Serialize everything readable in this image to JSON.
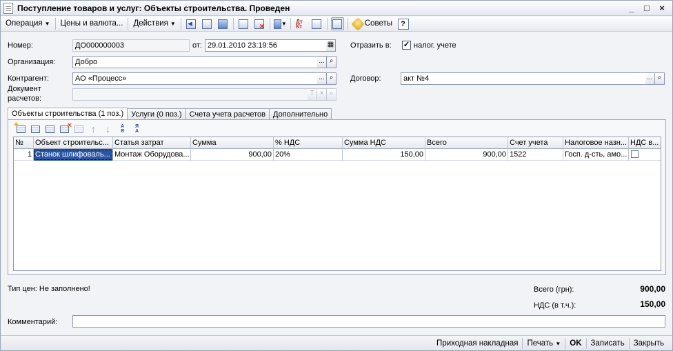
{
  "window": {
    "title": "Поступление товаров и услуг: Объекты строительства. Проведен",
    "controls": [
      "_",
      "□",
      "×"
    ]
  },
  "toolbar": {
    "operation": "Операция",
    "prices": "Цены и валюта...",
    "actions": "Действия",
    "tips": "Советы",
    "help": "?"
  },
  "form": {
    "number_label": "Номер:",
    "number_value": "ДО000000003",
    "date_label": "от:",
    "date_value": "29.01.2010 23:19:56",
    "reflect_label": "Отразить в:",
    "tax_checkbox_label": "налог. учете",
    "tax_checked": true,
    "org_label": "Организация:",
    "org_value": "Добро",
    "counterparty_label": "Контрагент:",
    "counterparty_value": "АО «Процесс»",
    "contract_label": "Договор:",
    "contract_value": "акт №4",
    "doc_label_1": "Документ",
    "doc_label_2": "расчетов:",
    "doc_value": "",
    "select_btn": "...",
    "clear_btn": "×",
    "type_btn": "T"
  },
  "tabs": [
    {
      "label": "Объекты строительства (1 поз.)",
      "active": true
    },
    {
      "label": "Услуги (0 поз.)",
      "active": false
    },
    {
      "label": "Счета учета расчетов",
      "active": false
    },
    {
      "label": "Дополнительно",
      "active": false
    }
  ],
  "grid": {
    "columns": [
      "№",
      "Объект строительс...",
      "Статья затрат",
      "Сумма",
      "% НДС",
      "Сумма НДС",
      "Всего",
      "Счет учета",
      "Налоговое назн...",
      "НДС в..."
    ],
    "rows": [
      {
        "n": "1",
        "object": "Станок шлифоваль...",
        "cost_item": "Монтаж Оборудова...",
        "sum": "900,00",
        "vat_rate": "20%",
        "vat_sum": "150,00",
        "total": "900,00",
        "account": "1522",
        "tax_purpose": "Госп. д-сть, амо...",
        "vat_in": false
      }
    ]
  },
  "footer": {
    "price_type": "Тип цен: Не заполнено!",
    "total_label": "Всего (грн):",
    "total_value": "900,00",
    "vat_label": "НДС (в т.ч.):",
    "vat_value": "150,00",
    "comment_label": "Комментарий:",
    "comment_value": ""
  },
  "statusbar": {
    "invoice": "Приходная накладная",
    "print": "Печать",
    "ok": "OK",
    "save": "Записать",
    "close": "Закрыть"
  }
}
